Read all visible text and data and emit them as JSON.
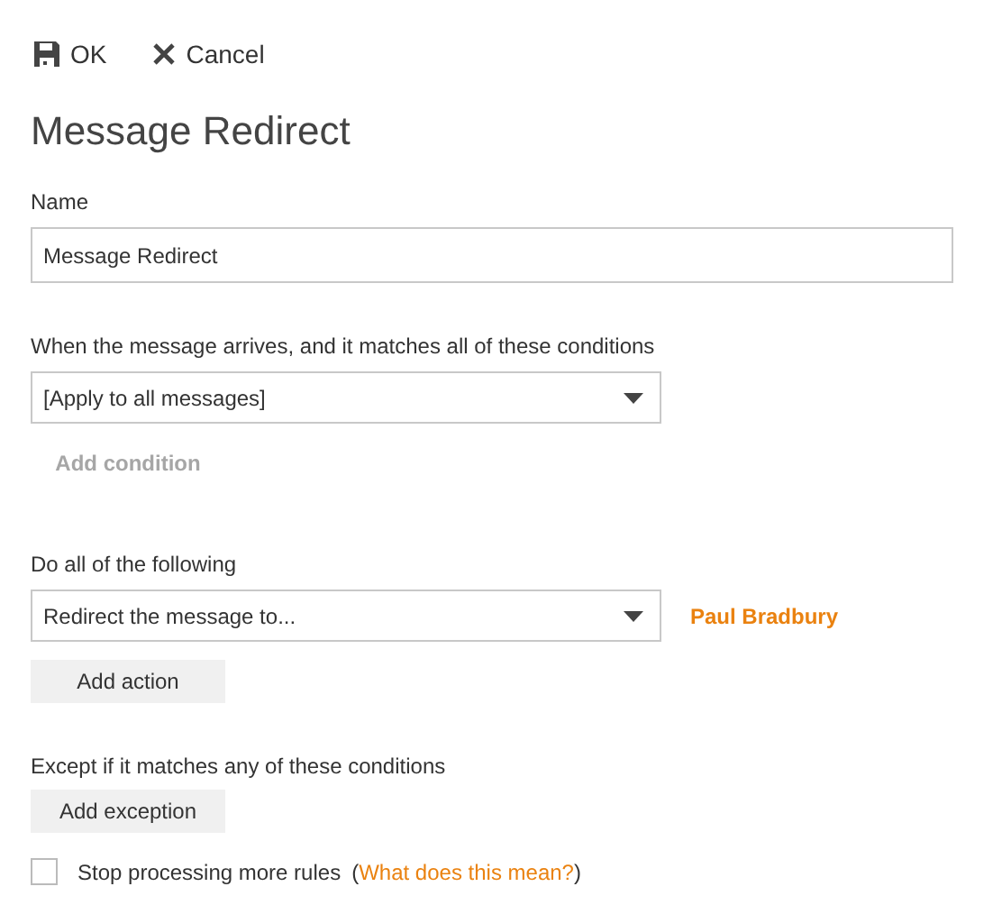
{
  "toolbar": [
    {
      "kind": "save",
      "label": "OK"
    },
    {
      "kind": "close",
      "label": "Cancel"
    }
  ],
  "title": "Message Redirect",
  "name_field": {
    "label": "Name",
    "value": "Message Redirect"
  },
  "conditions": {
    "label": "When the message arrives, and it matches all of these conditions",
    "select": "[Apply to all messages]",
    "button": {
      "label": "Add condition",
      "disabled": true
    }
  },
  "actions": {
    "label": "Do all of the following",
    "select": "Redirect the message to...",
    "recipient": "Paul Bradbury",
    "button": {
      "label": "Add action",
      "disabled": false
    }
  },
  "exceptions": {
    "label": "Except if it matches any of these conditions",
    "button": {
      "label": "Add exception",
      "disabled": false
    }
  },
  "stop_processing": {
    "label": "Stop processing more rules",
    "checked": false,
    "open_paren": "(",
    "link": "What does this mean?",
    "close_paren": ")"
  }
}
